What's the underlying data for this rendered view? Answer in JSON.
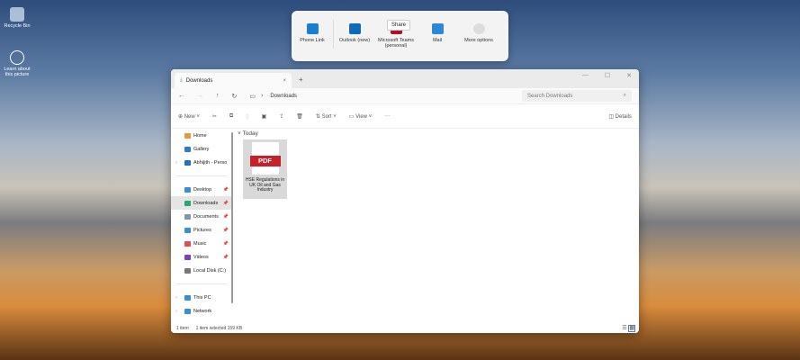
{
  "desktop": [
    {
      "label": "Recycle Bin",
      "icon": "recycle-bin-icon"
    },
    {
      "label": "Learn about this picture",
      "icon": "learn-icon"
    }
  ],
  "share": {
    "tooltip": "Share",
    "targets": [
      {
        "label": "Phone Link",
        "color": "#1a7fd4"
      },
      {
        "label": "Outlook (new)",
        "color": "#0f6cbd"
      },
      {
        "label": "Microsoft Teams (personal)",
        "color": "#b0102a"
      },
      {
        "label": "Mail",
        "color": "#2b88d8"
      },
      {
        "label": "More options",
        "color": "#dddddd"
      }
    ]
  },
  "window": {
    "tab": "Downloads",
    "address": "Downloads",
    "search_placeholder": "Search Downloads",
    "toolbar": {
      "new": "New",
      "sort": "Sort",
      "view": "View",
      "more": "···",
      "details": "Details"
    },
    "nav": [
      {
        "label": "Home",
        "color": "#e59a3a"
      },
      {
        "label": "Gallery",
        "color": "#2b7bd0"
      },
      {
        "label": "Abhijith - Perso",
        "color": "#1f6fc4",
        "chev": true
      },
      {
        "sep": true
      },
      {
        "label": "Desktop",
        "color": "#3a8ed8",
        "pin": true
      },
      {
        "label": "Downloads",
        "color": "#2aa57a",
        "pin": true,
        "sel": true
      },
      {
        "label": "Documents",
        "color": "#8096b0",
        "pin": true
      },
      {
        "label": "Pictures",
        "color": "#3b8fd6",
        "pin": true
      },
      {
        "label": "Music",
        "color": "#d9534f",
        "pin": true
      },
      {
        "label": "Videos",
        "color": "#7a3fc4",
        "pin": true
      },
      {
        "label": "Local Disk (C:)",
        "color": "#777777"
      },
      {
        "sep": true
      },
      {
        "label": "This PC",
        "color": "#3a8ed8",
        "chev": true
      },
      {
        "label": "Network",
        "color": "#3a8ed8",
        "chev": true
      }
    ],
    "group": "Today",
    "file": {
      "badge": "PDF",
      "name": "HSE Regulations in UK Oil and Gas Industry"
    },
    "status": {
      "count": "1 item",
      "selected": "1 item selected  159 KB"
    }
  }
}
